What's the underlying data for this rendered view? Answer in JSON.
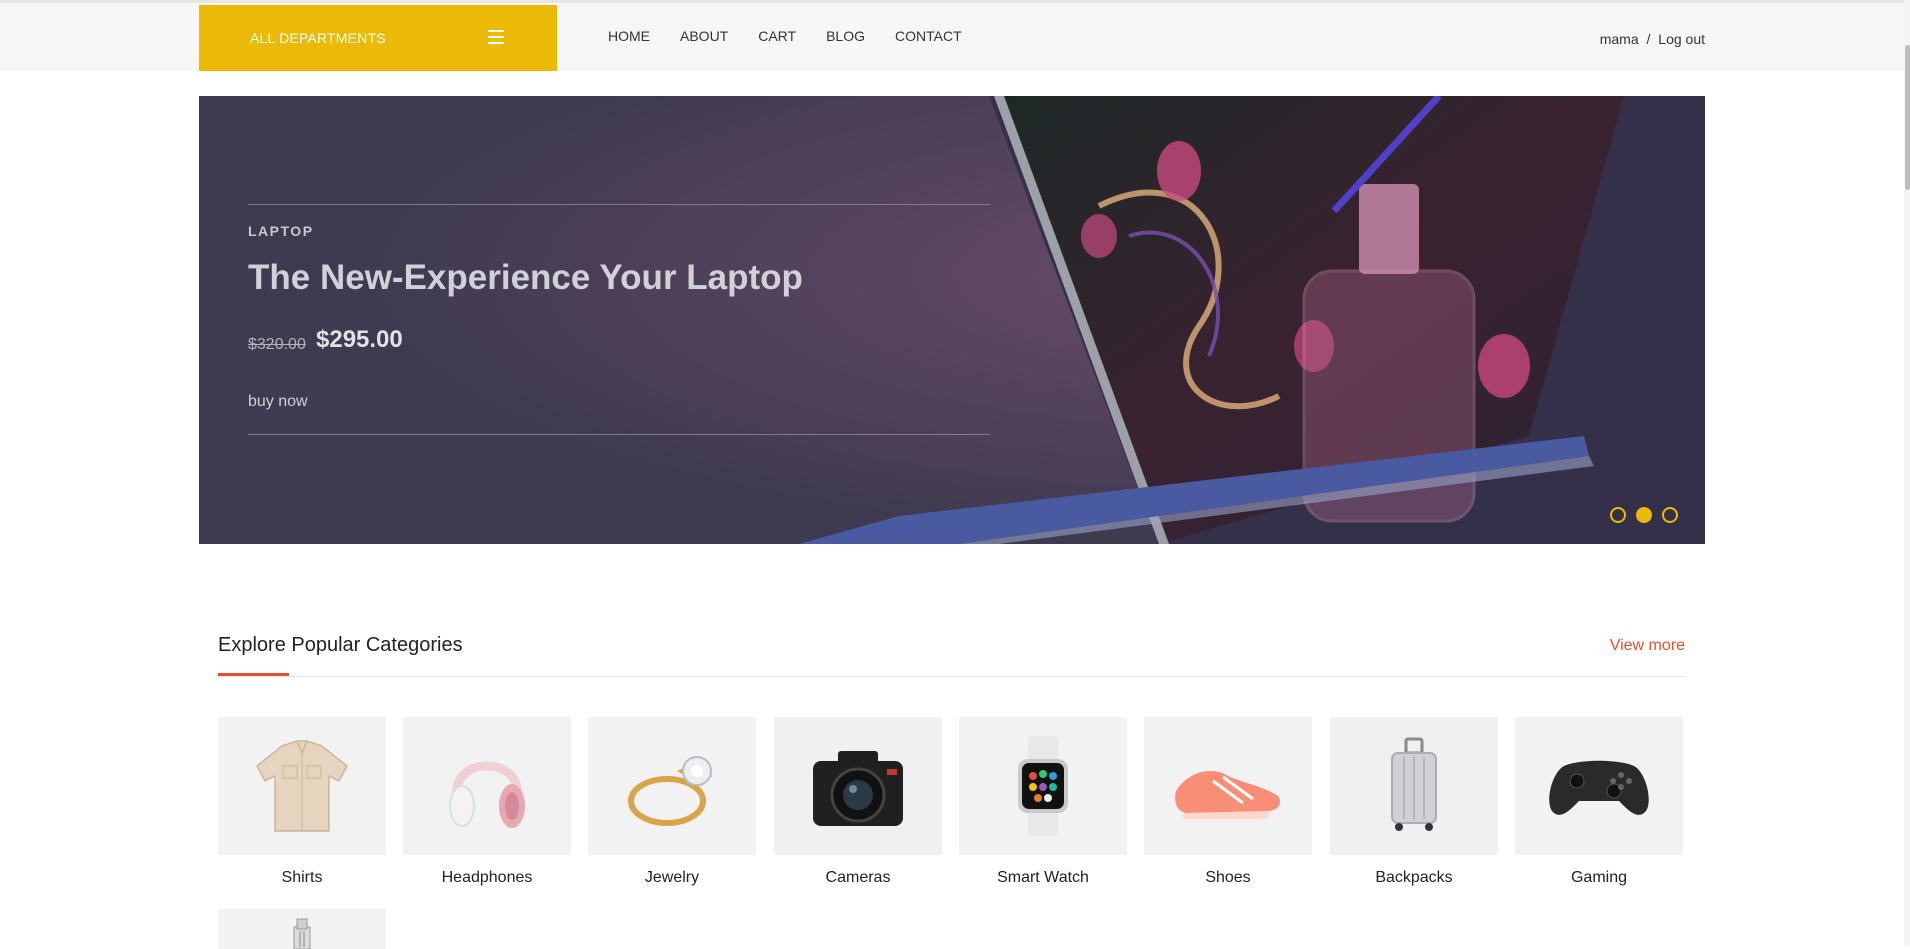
{
  "header": {
    "departments_label": "ALL DEPARTMENTS",
    "nav": [
      "HOME",
      "ABOUT",
      "CART",
      "BLOG",
      "CONTACT"
    ],
    "user": "mama",
    "separator": "/",
    "logout": "Log out",
    "accent": "#eaba07"
  },
  "hero": {
    "category": "LAPTOP",
    "title": "The New-Experience Your Laptop",
    "old_price": "$320.00",
    "new_price": "$295.00",
    "cta": "buy now",
    "slides": 3,
    "active_slide": 2
  },
  "categories": {
    "title": "Explore Popular Categories",
    "view_more": "View more",
    "accent": "#e6502b",
    "items": [
      {
        "label": "Shirts",
        "icon": "shirt-icon"
      },
      {
        "label": "Headphones",
        "icon": "headphones-icon"
      },
      {
        "label": "Jewelry",
        "icon": "ring-icon"
      },
      {
        "label": "Cameras",
        "icon": "camera-icon"
      },
      {
        "label": "Smart Watch",
        "icon": "watch-icon"
      },
      {
        "label": "Shoes",
        "icon": "shoe-icon"
      },
      {
        "label": "Backpacks",
        "icon": "suitcase-icon"
      },
      {
        "label": "Gaming",
        "icon": "gamepad-icon"
      }
    ]
  }
}
